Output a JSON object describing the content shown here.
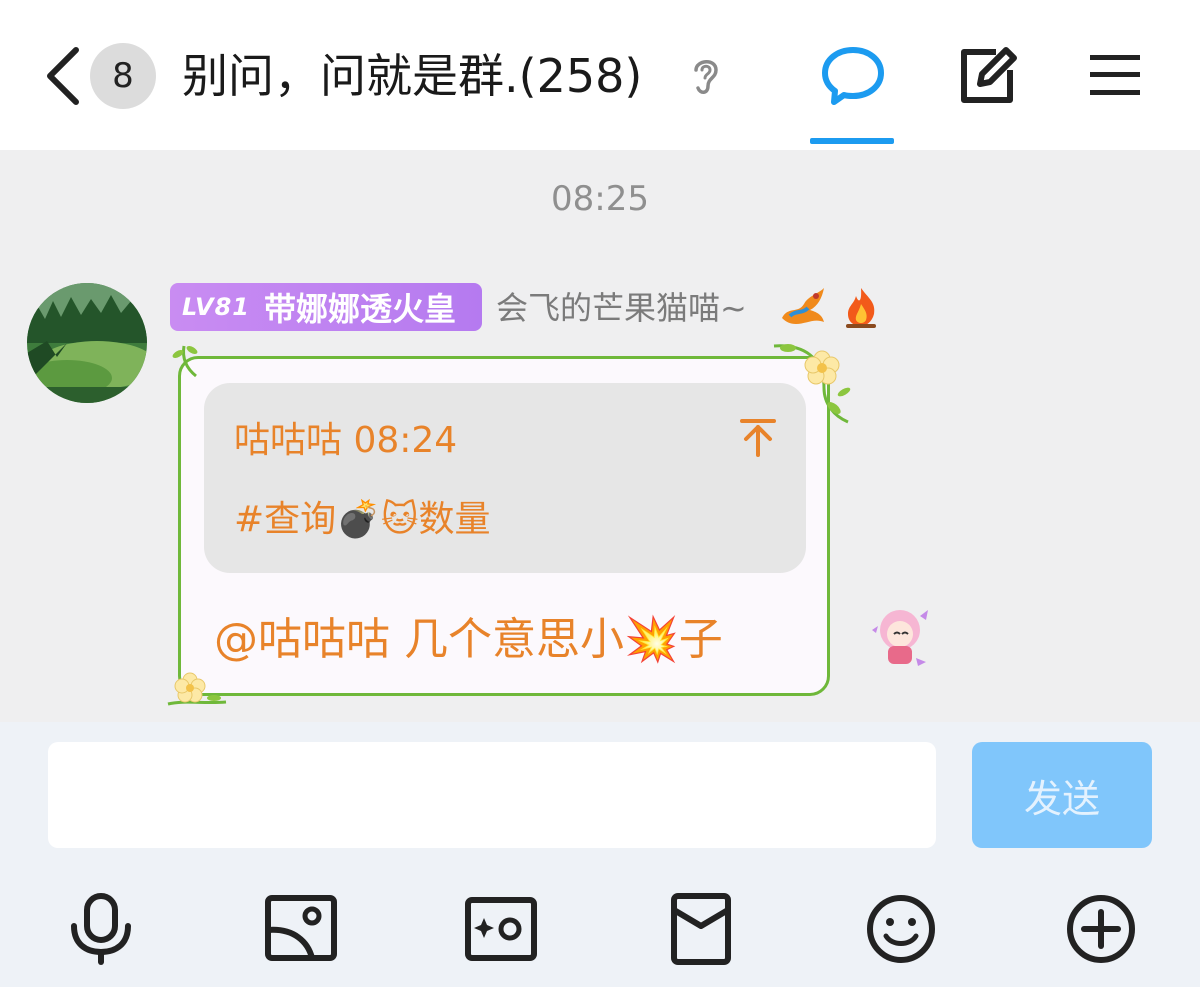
{
  "header": {
    "unread_count": "8",
    "group_title": "别问，问就是群.(258)"
  },
  "timestamp": "08:25",
  "message": {
    "level": "LV81",
    "level_title": "带娜娜透火皇",
    "nickname": "会飞的芒果猫喵~",
    "quote_author_time": "咕咕咕 08:24",
    "quote_text": "#查询💣🐱数量",
    "text": "@咕咕咕 几个意思小💥子"
  },
  "input": {
    "value": "",
    "placeholder": "",
    "send_label": "发送"
  },
  "toolbar": {
    "icons": [
      "microphone-icon",
      "image-icon",
      "camera-icon",
      "red-packet-icon",
      "emoji-icon",
      "plus-icon"
    ]
  },
  "colors": {
    "accent": "#1c9bf0",
    "message_text": "#e8832a",
    "bubble_border": "#6fb83a",
    "send_button": "#80c6fb"
  }
}
